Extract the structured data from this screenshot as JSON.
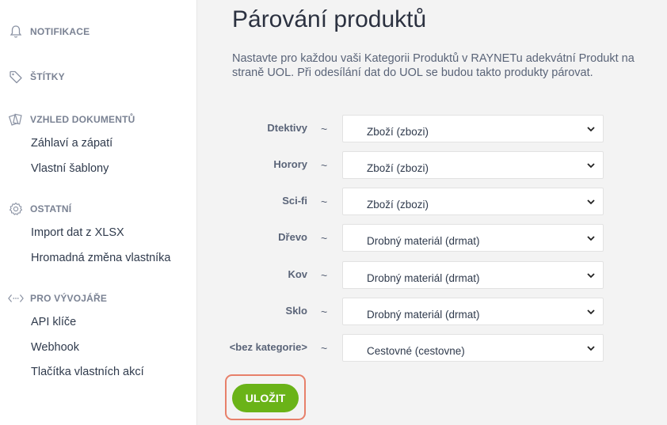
{
  "sidebar": {
    "notifications": {
      "title": "NOTIFIKACE",
      "icon": "bell-icon"
    },
    "tags": {
      "title": "ŠTÍTKY",
      "icon": "tag-icon"
    },
    "documents": {
      "title": "VZHLED DOKUMENTŮ",
      "icon": "documents-icon",
      "items": [
        "Záhlaví a zápatí",
        "Vlastní šablony"
      ]
    },
    "other": {
      "title": "OSTATNÍ",
      "icon": "gear-icon",
      "items": [
        "Import dat z XLSX",
        "Hromadná změna vlastníka"
      ]
    },
    "developers": {
      "title": "PRO VÝVOJÁŘE",
      "icon": "code-icon",
      "items": [
        "API klíče",
        "Webhook",
        "Tlačítka vlastních akcí"
      ]
    }
  },
  "main": {
    "title": "Párování produktů",
    "description": "Nastavte pro každou vaši Kategorii Produktů v RAYNETu adekvátní Produkt na straně UOL. Při odesílání dat do UOL se budou takto produkty párovat.",
    "mappings": [
      {
        "category": "Dtektivy",
        "separator": "~",
        "product": "Zboží (zbozi)"
      },
      {
        "category": "Horory",
        "separator": "~",
        "product": "Zboží (zbozi)"
      },
      {
        "category": "Sci-fi",
        "separator": "~",
        "product": "Zboží (zbozi)"
      },
      {
        "category": "Dřevo",
        "separator": "~",
        "product": "Drobný materiál (drmat)"
      },
      {
        "category": "Kov",
        "separator": "~",
        "product": "Drobný materiál (drmat)"
      },
      {
        "category": "Sklo",
        "separator": "~",
        "product": "Drobný materiál (drmat)"
      },
      {
        "category": "<bez kategorie>",
        "separator": "~",
        "product": "Cestovné (cestovne)"
      }
    ],
    "save_label": "ULOŽIT",
    "accent_color": "#6ab318",
    "highlight_color": "#e7806a"
  }
}
